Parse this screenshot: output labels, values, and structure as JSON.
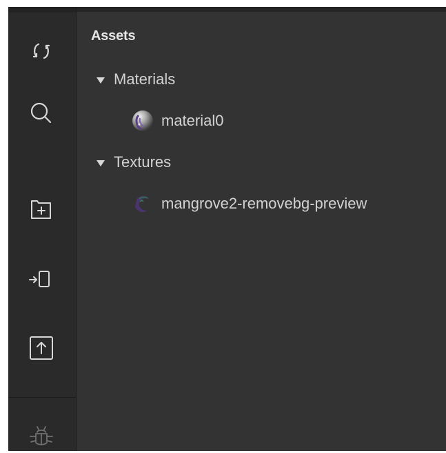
{
  "toolbar": {
    "tools": [
      {
        "name": "refresh",
        "icon": "refresh-icon"
      },
      {
        "name": "search",
        "icon": "search-icon"
      },
      {
        "name": "new-folder",
        "icon": "folder-plus-icon"
      },
      {
        "name": "import",
        "icon": "import-icon"
      },
      {
        "name": "upload",
        "icon": "upload-icon"
      },
      {
        "name": "debug",
        "icon": "bug-icon"
      }
    ]
  },
  "assets": {
    "title": "Assets",
    "groups": [
      {
        "label": "Materials",
        "expanded": true,
        "items": [
          {
            "label": "material0",
            "icon": "material-sphere-icon"
          }
        ]
      },
      {
        "label": "Textures",
        "expanded": true,
        "items": [
          {
            "label": "mangrove2-removebg-preview",
            "icon": "texture-thumbnail-icon"
          }
        ]
      }
    ]
  },
  "colors": {
    "toolbar_bg": "#2a2a2a",
    "panel_bg": "#333333",
    "text": "#d2d2d2",
    "icon": "#d8d8d8"
  }
}
